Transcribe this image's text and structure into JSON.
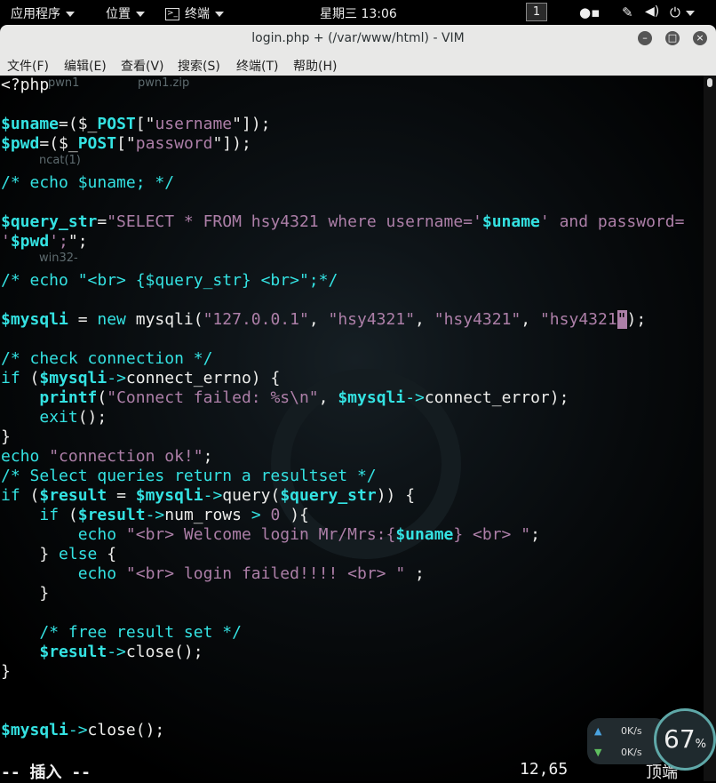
{
  "topbar": {
    "apps": "应用程序",
    "places": "位置",
    "terminal": "终端",
    "clock": "星期三 13:06",
    "workspace": "1"
  },
  "window": {
    "title": "login.php + (/var/www/html) - VIM"
  },
  "menu": [
    "文件(F)",
    "编辑(E)",
    "查看(V)",
    "搜索(S)",
    "终端(T)",
    "帮助(H)"
  ],
  "desktop_icons": [
    "pwn1",
    "pwn1.zip",
    "ncat(1)",
    "win32-"
  ],
  "code": [
    [
      [
        "w",
        "<?php"
      ]
    ],
    [],
    [
      [
        "var",
        "$uname"
      ],
      [
        "w",
        "=($_"
      ],
      [
        "var",
        "POST"
      ],
      [
        "w",
        "[\""
      ],
      [
        "str",
        "username"
      ],
      [
        "w",
        "\"]);"
      ]
    ],
    [
      [
        "var",
        "$pwd"
      ],
      [
        "w",
        "=($_"
      ],
      [
        "var",
        "POST"
      ],
      [
        "w",
        "[\""
      ],
      [
        "str",
        "password"
      ],
      [
        "w",
        "\"]);"
      ]
    ],
    [],
    [
      [
        "cm",
        "/* echo $uname; */"
      ]
    ],
    [],
    [
      [
        "var",
        "$query_str"
      ],
      [
        "w",
        "="
      ],
      [
        "str",
        "\"SELECT * FROM hsy4321 where username='"
      ],
      [
        "var",
        "$uname"
      ],
      [
        "str",
        "' and password="
      ]
    ],
    [
      [
        "str",
        "'"
      ],
      [
        "var",
        "$pwd"
      ],
      [
        "str",
        "';"
      ],
      [
        "w",
        "\";"
      ]
    ],
    [],
    [
      [
        "cm",
        "/* echo \"<br> {$query_str} <br>\";*/"
      ]
    ],
    [],
    [
      [
        "var",
        "$mysqli"
      ],
      [
        "w",
        " = "
      ],
      [
        "kw",
        "new"
      ],
      [
        "w",
        " mysqli("
      ],
      [
        "str",
        "\"127.0.0.1\""
      ],
      [
        "w",
        ", "
      ],
      [
        "str",
        "\"hsy4321\""
      ],
      [
        "w",
        ", "
      ],
      [
        "str",
        "\"hsy4321\""
      ],
      [
        "w",
        ", "
      ],
      [
        "str",
        "\"hsy4321"
      ],
      [
        "cur",
        "\""
      ],
      [
        "w",
        ");"
      ]
    ],
    [],
    [
      [
        "cm",
        "/* check connection */"
      ]
    ],
    [
      [
        "kw",
        "if"
      ],
      [
        "w",
        " ("
      ],
      [
        "var",
        "$mysqli"
      ],
      [
        "kw",
        "->"
      ],
      [
        "w",
        "connect_errno) {"
      ]
    ],
    [
      [
        "w",
        "    "
      ],
      [
        "var",
        "printf"
      ],
      [
        "w",
        "("
      ],
      [
        "str",
        "\"Connect failed: %s\\n\""
      ],
      [
        "w",
        ", "
      ],
      [
        "var",
        "$mysqli"
      ],
      [
        "kw",
        "->"
      ],
      [
        "w",
        "connect_error);"
      ]
    ],
    [
      [
        "w",
        "    "
      ],
      [
        "kw",
        "exit"
      ],
      [
        "w",
        "();"
      ]
    ],
    [
      [
        "w",
        "}"
      ]
    ],
    [
      [
        "kw",
        "echo"
      ],
      [
        "w",
        " "
      ],
      [
        "str",
        "\"connection ok!\""
      ],
      [
        "w",
        ";"
      ]
    ],
    [
      [
        "cm",
        "/* Select queries return a resultset */"
      ]
    ],
    [
      [
        "kw",
        "if"
      ],
      [
        "w",
        " ("
      ],
      [
        "var",
        "$result"
      ],
      [
        "w",
        " = "
      ],
      [
        "var",
        "$mysqli"
      ],
      [
        "kw",
        "->"
      ],
      [
        "w",
        "query("
      ],
      [
        "var",
        "$query_str"
      ],
      [
        "w",
        ")) {"
      ]
    ],
    [
      [
        "w",
        "    "
      ],
      [
        "kw",
        "if"
      ],
      [
        "w",
        " ("
      ],
      [
        "var",
        "$result"
      ],
      [
        "kw",
        "->"
      ],
      [
        "w",
        "num_rows "
      ],
      [
        "kw",
        ">"
      ],
      [
        "w",
        " "
      ],
      [
        "str",
        "0"
      ],
      [
        "w",
        " ){"
      ]
    ],
    [
      [
        "w",
        "        "
      ],
      [
        "kw",
        "echo"
      ],
      [
        "w",
        " "
      ],
      [
        "str",
        "\"<br> Welcome login Mr/Mrs:{"
      ],
      [
        "var",
        "$uname"
      ],
      [
        "str",
        "} <br> \""
      ],
      [
        "w",
        ";"
      ]
    ],
    [
      [
        "w",
        "    } "
      ],
      [
        "kw",
        "else"
      ],
      [
        "w",
        " {"
      ]
    ],
    [
      [
        "w",
        "        "
      ],
      [
        "kw",
        "echo"
      ],
      [
        "w",
        " "
      ],
      [
        "str",
        "\"<br> login failed!!!! <br> \""
      ],
      [
        "w",
        " ;"
      ]
    ],
    [
      [
        "w",
        "    }"
      ]
    ],
    [],
    [
      [
        "w",
        "    "
      ],
      [
        "cm",
        "/* free result set */"
      ]
    ],
    [
      [
        "w",
        "    "
      ],
      [
        "var",
        "$result"
      ],
      [
        "kw",
        "->"
      ],
      [
        "w",
        "close();"
      ]
    ],
    [
      [
        "w",
        "}"
      ]
    ],
    [],
    [],
    [
      [
        "var",
        "$mysqli"
      ],
      [
        "kw",
        "->"
      ],
      [
        "w",
        "close();"
      ]
    ]
  ],
  "status": {
    "mode": "-- 插入 --",
    "position": "12,65",
    "scroll": "顶端"
  },
  "netmon": {
    "up": "0K/s",
    "down": "0K/s",
    "percent": "67",
    "percent_unit": "%"
  }
}
